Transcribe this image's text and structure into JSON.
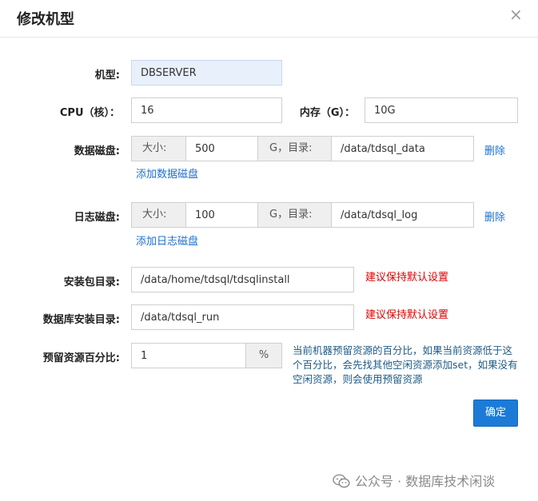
{
  "dialog": {
    "title": "修改机型",
    "close_glyph": "×"
  },
  "model": {
    "label": "机型:",
    "value": "DBSERVER"
  },
  "cpu": {
    "label": "CPU（核）：",
    "value": "16"
  },
  "memory": {
    "label": "内存（G）：",
    "value": "10G"
  },
  "data_disk": {
    "label": "数据磁盘:",
    "size_label": "大小:",
    "size_value": "500",
    "dir_label": "G，目录:",
    "dir_value": "/data/tdsql_data",
    "delete_label": "删除",
    "add_label": "添加数据磁盘"
  },
  "log_disk": {
    "label": "日志磁盘:",
    "size_label": "大小:",
    "size_value": "100",
    "dir_label": "G，目录:",
    "dir_value": "/data/tdsql_log",
    "delete_label": "删除",
    "add_label": "添加日志磁盘"
  },
  "install_dir": {
    "label": "安装包目录:",
    "value": "/data/home/tdsql/tdsqlinstall",
    "warning": "建议保持默认设置"
  },
  "db_install_dir": {
    "label": "数据库安装目录:",
    "value": "/data/tdsql_run",
    "warning": "建议保持默认设置"
  },
  "reserve": {
    "label": "预留资源百分比:",
    "value": "1",
    "unit": "%",
    "hint": "当前机器预留资源的百分比，如果当前资源低于这个百分比，会先找其他空闲资源添加set，如果没有空闲资源，则会使用预留资源"
  },
  "confirm_label": "确定",
  "watermark": {
    "text": "公众号 · 数据库技术闲谈",
    "icon": "wechat-icon"
  },
  "colors": {
    "accent": "#1b7bd6",
    "link": "#1e6fd0",
    "warning": "#e00000",
    "hint": "#1f5b86"
  }
}
